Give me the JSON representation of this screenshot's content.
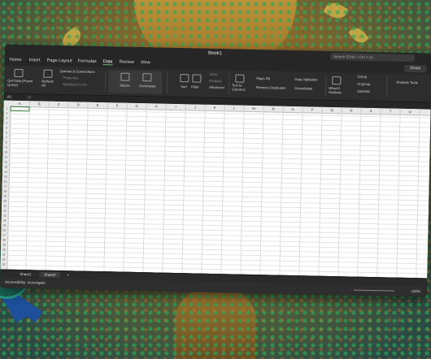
{
  "window": {
    "title": "Book1",
    "search_placeholder": "Search (Cmd + Ctrl + U)"
  },
  "menu_tabs": [
    "Home",
    "Insert",
    "Page Layout",
    "Formulas",
    "Data",
    "Review",
    "View"
  ],
  "active_tab": "Data",
  "share_label": "Share",
  "ribbon": {
    "get_data": "Get Data (Power Query)",
    "refresh_all": "Refresh All",
    "queries_connections": "Queries & Connections",
    "properties": "Properties",
    "workbook_links": "Workbook Links",
    "stocks": "Stocks",
    "currencies": "Currencies",
    "sort": "Sort",
    "filter": "Filter",
    "clear": "Clear",
    "reapply": "Reapply",
    "advanced": "Advanced",
    "text_to_columns": "Text to Columns",
    "flash_fill": "Flash Fill",
    "remove_duplicates": "Remove Duplicates",
    "data_validation": "Data Validation",
    "consolidate": "Consolidate",
    "what_if": "What-If Analysis",
    "group": "Group",
    "ungroup": "Ungroup",
    "subtotal": "Subtotal",
    "analysis_tools": "Analysis Tools"
  },
  "formula_bar": {
    "name_box": "A1",
    "fx": "fx"
  },
  "columns": [
    "A",
    "B",
    "C",
    "D",
    "E",
    "F",
    "G",
    "H",
    "I",
    "J",
    "K",
    "L",
    "M",
    "N",
    "O",
    "P",
    "Q",
    "R",
    "S",
    "T",
    "U"
  ],
  "rows": [
    "1",
    "2",
    "3",
    "4",
    "5",
    "6",
    "7",
    "8",
    "9",
    "10",
    "11",
    "12",
    "13",
    "14",
    "15",
    "16",
    "17",
    "18",
    "19",
    "20",
    "21",
    "22",
    "23",
    "24",
    "25",
    "26",
    "27",
    "28",
    "29",
    "30",
    "31",
    "32",
    "33"
  ],
  "sheets": [
    "Sheet1",
    "Sheet2"
  ],
  "active_sheet": "Sheet2",
  "status": {
    "accessibility": "Accessibility: Investigate",
    "zoom": "100%"
  },
  "colors": {
    "accent": "#6fbf6f",
    "background_dots": "#28aa5a"
  }
}
